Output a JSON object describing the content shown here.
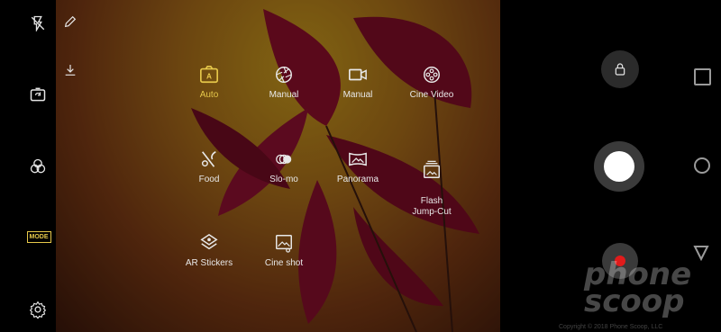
{
  "left_toolbar": {
    "icons": [
      "flash-off-icon",
      "switch-camera-icon",
      "filter-icon",
      "mode-icon",
      "settings-icon"
    ],
    "mode_badge": "MODE"
  },
  "edit_icons": [
    "edit-pencil-icon",
    "download-icon"
  ],
  "modes": [
    {
      "label": "Auto",
      "icon": "auto-mode-icon",
      "active": true
    },
    {
      "label": "Manual",
      "icon": "aperture-icon",
      "active": false
    },
    {
      "label": "Manual",
      "icon": "video-camera-icon",
      "active": false
    },
    {
      "label": "Cine Video",
      "icon": "film-reel-icon",
      "active": false
    },
    {
      "label": "Food",
      "icon": "food-utensils-icon",
      "active": false
    },
    {
      "label": "Slo-mo",
      "icon": "slow-motion-icon",
      "active": false
    },
    {
      "label": "Panorama",
      "icon": "panorama-icon",
      "active": false
    },
    {
      "label": "Flash\nJump-Cut",
      "icon": "flash-jumpcut-icon",
      "active": false
    },
    {
      "label": "AR Stickers",
      "icon": "ar-stickers-icon",
      "active": false
    },
    {
      "label": "Cine shot",
      "icon": "cine-shot-icon",
      "active": false
    }
  ],
  "right_controls": [
    "lock-icon",
    "shutter-button",
    "record-button"
  ],
  "nav_bar": [
    "recents-square",
    "home-circle",
    "back-triangle"
  ],
  "watermark": {
    "line1": "phone",
    "line2": "scoop",
    "credit": "Copyright © 2018 Phone Scoop, LLC"
  },
  "colors": {
    "active": "#e6c84a",
    "record": "#e01b1b",
    "icon": "#e6e6e6"
  }
}
